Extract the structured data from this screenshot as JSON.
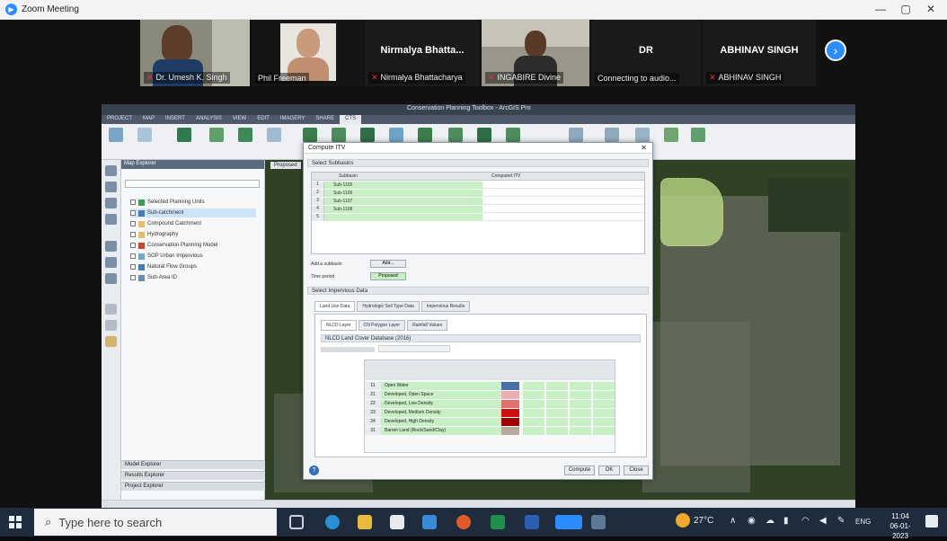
{
  "window": {
    "title": "Zoom Meeting",
    "minimize": "—",
    "restore": "▢",
    "close": "✕"
  },
  "participants": [
    {
      "name": "Dr. Umesh K. Singh"
    },
    {
      "name": "Phil Freeman"
    },
    {
      "display": "Nirmalya  Bhatta...",
      "name": "Nirmalya Bhattacharya"
    },
    {
      "name": "INGABIRE Divine"
    },
    {
      "display": "DR",
      "name": "Connecting to audio..."
    },
    {
      "display": "ABHINAV SINGH",
      "name": "ABHINAV SINGH"
    }
  ],
  "next_arrow": "›",
  "shared": {
    "app_title": "Conservation Planning Toolbox - ArcGIS Pro",
    "ribbon_tabs": [
      "PROJECT",
      "MAP",
      "INSERT",
      "ANALYSIS",
      "VIEW",
      "EDIT",
      "IMAGERY",
      "SHARE",
      "CTS"
    ],
    "explorer_title": "Map Explorer",
    "layers": [
      "Selected Planning Units",
      "Sub-catchment",
      "Compound Catchment",
      "Hydrography",
      "Conservation Planning Model",
      "SOP Urban Impervious",
      "Natural Flow Groups",
      "Sub-Area ID"
    ],
    "explorer_footer": [
      "Model Explorer",
      "Results Explorer",
      "Project Explorer"
    ],
    "map_tab": "Proposed",
    "status": "",
    "dialog": {
      "title": "Compute ITV",
      "close": "✕",
      "select_label": "Select Subbasins",
      "columns": [
        "Subbasin",
        "Computed ITV"
      ],
      "rows": [
        {
          "num": "1",
          "name": "Sub-1105"
        },
        {
          "num": "2",
          "name": "Sub-1106"
        },
        {
          "num": "3",
          "name": "Sub-1107"
        },
        {
          "num": "4",
          "name": "Sub-1108"
        },
        {
          "num": "5",
          "name": ""
        }
      ],
      "load_label": "Add a subbasin",
      "load_btn": "Add...",
      "time_label": "Time period",
      "time_value": "Proposed",
      "imperv_label": "Select Impervious Data",
      "tabs": [
        "Land Use Data",
        "Hydrologic Soil Type Data",
        "Impervious Results"
      ],
      "subtabs": [
        "NLCD Layer",
        "CN Polygon Layer",
        "Rainfall Values"
      ],
      "lc_header": "NLCD Land Cover Database (2016)",
      "lc_rows": [
        {
          "code": "11",
          "name": "Open Water",
          "color": "#4a6fa8"
        },
        {
          "code": "21",
          "name": "Developed, Open Space",
          "color": "#e8b0b0"
        },
        {
          "code": "22",
          "name": "Developed, Low Density",
          "color": "#e07070"
        },
        {
          "code": "23",
          "name": "Developed, Medium Density",
          "color": "#d01010"
        },
        {
          "code": "24",
          "name": "Developed, High Density",
          "color": "#a00000"
        },
        {
          "code": "31",
          "name": "Barren Land (Rock/Sand/Clay)",
          "color": "#b8a99a"
        }
      ],
      "buttons": [
        "Compute",
        "OK",
        "Close"
      ]
    }
  },
  "taskbar": {
    "search_placeholder": "Type here to search",
    "weather": "27°C",
    "lang": "ENG",
    "time": "11:04",
    "date": "06-01-2023"
  },
  "colors": {
    "zoom_blue": "#2d8cff",
    "subbasin_green": "#c8f0c4",
    "taskbar": "#1f2c3d"
  }
}
